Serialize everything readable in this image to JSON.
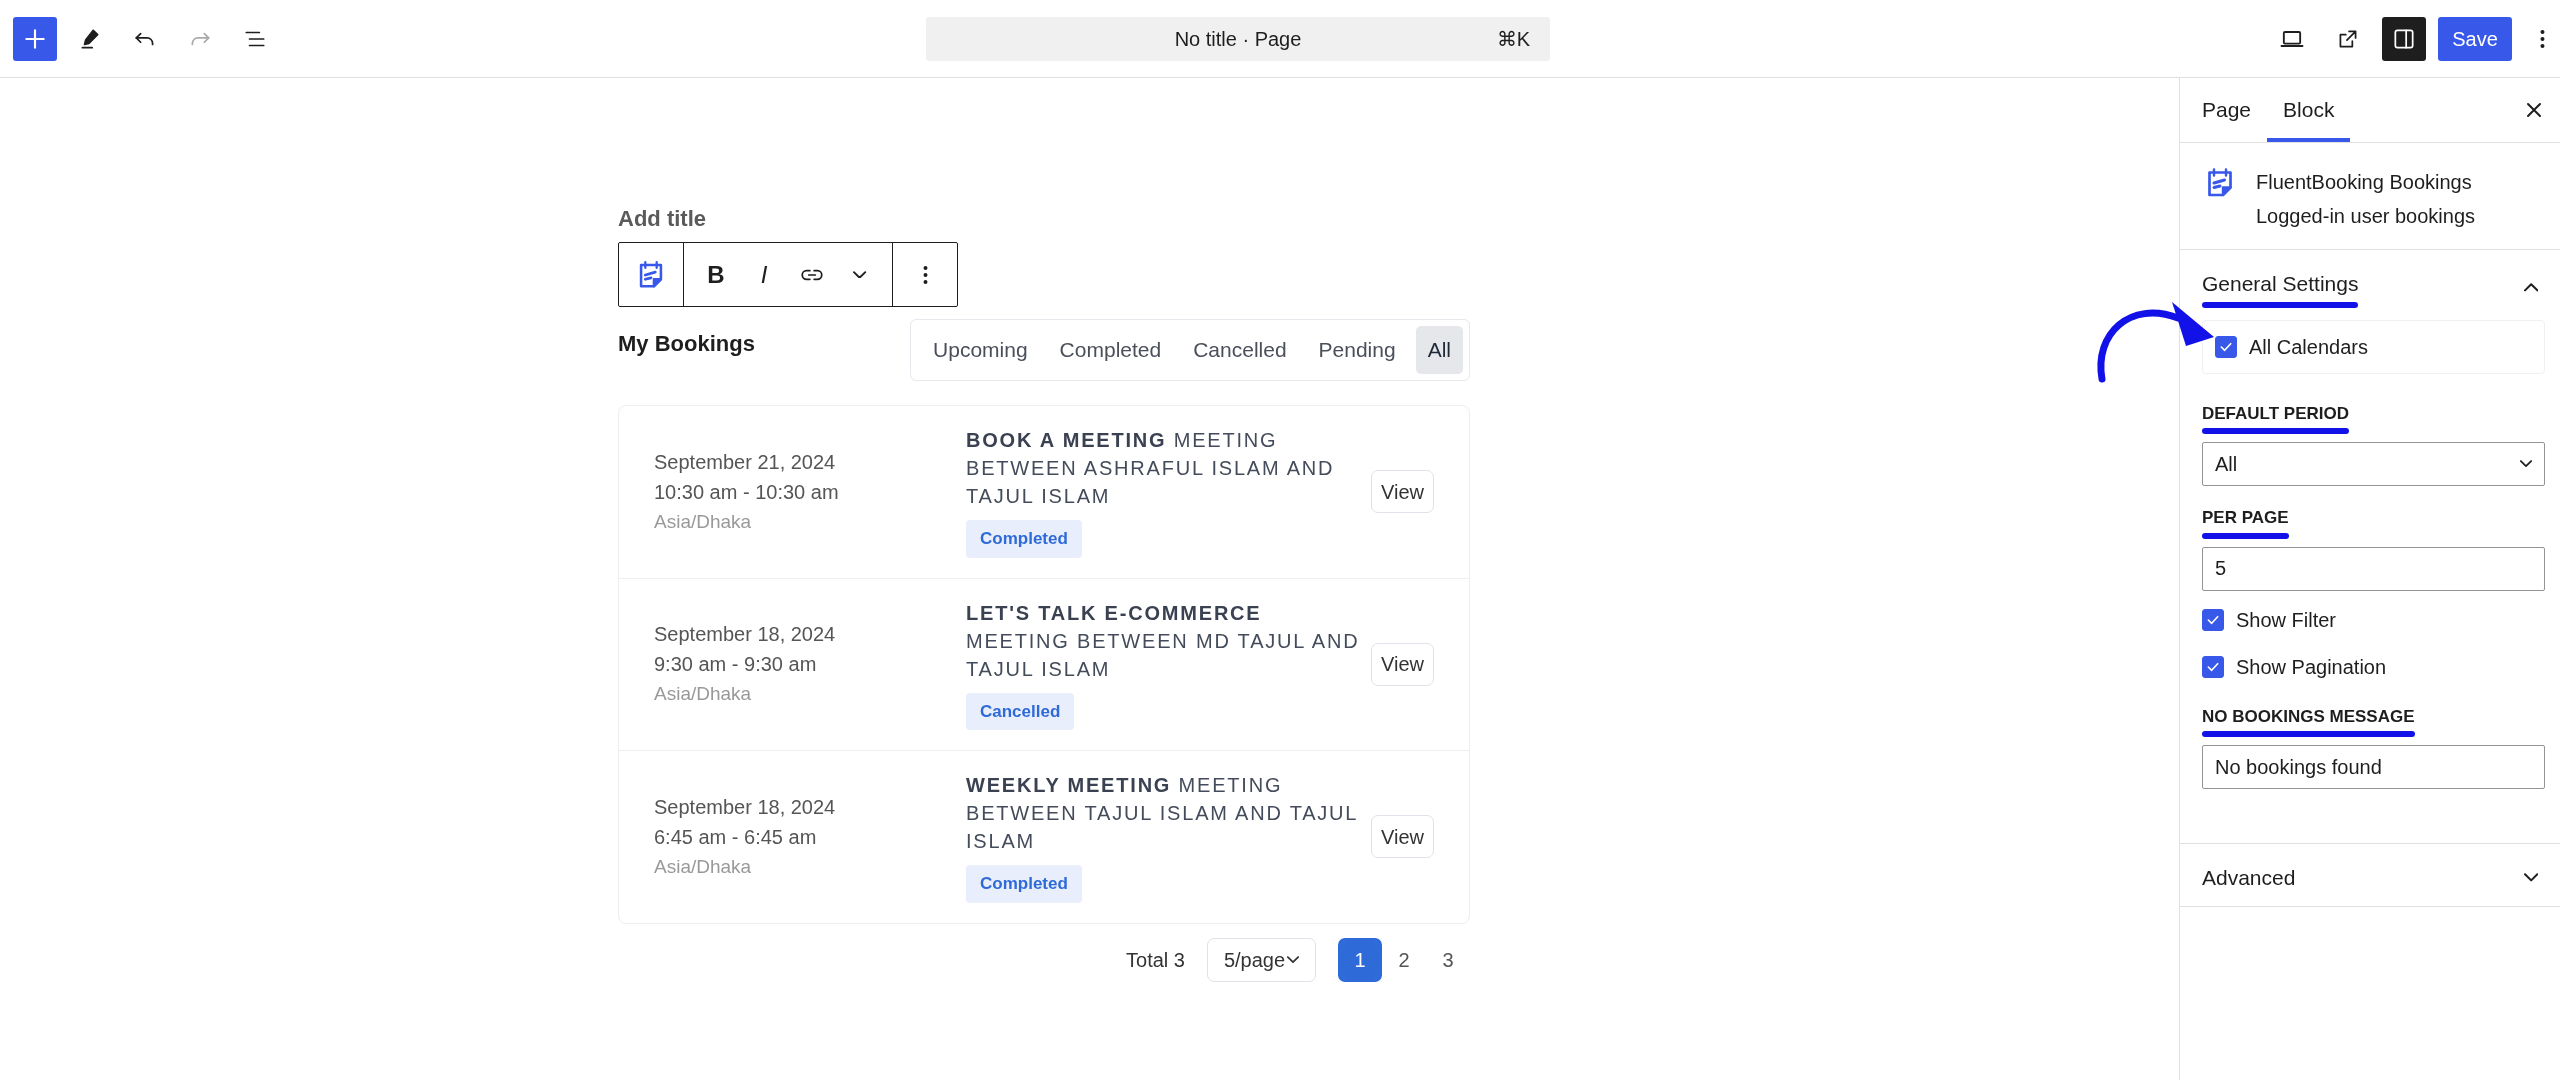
{
  "topbar": {
    "title": "No title · Page",
    "shortcut": "⌘K",
    "save": "Save"
  },
  "editor": {
    "title_placeholder": "Add title",
    "block_toolbar": {
      "format": [
        "B",
        "I"
      ]
    },
    "heading": "My Bookings",
    "filters": [
      {
        "label": "Upcoming",
        "selected": false
      },
      {
        "label": "Completed",
        "selected": false
      },
      {
        "label": "Cancelled",
        "selected": false
      },
      {
        "label": "Pending",
        "selected": false
      },
      {
        "label": "All",
        "selected": true
      }
    ],
    "bookings": [
      {
        "date": "September 21, 2024",
        "time": "10:30 am - 10:30 am",
        "timezone": "Asia/Dhaka",
        "title": "**BOOK A MEETING** MEETING BETWEEN ASHRAFUL ISLAM AND TAJUL ISLAM",
        "status": "Completed",
        "action": "View"
      },
      {
        "date": "September 18, 2024",
        "time": "9:30 am - 9:30 am",
        "timezone": "Asia/Dhaka",
        "title": "**LET'S TALK E-COMMERCE** MEETING BETWEEN MD TAJUL AND TAJUL ISLAM",
        "status": "Cancelled",
        "action": "View"
      },
      {
        "date": "September 18, 2024",
        "time": "6:45 am - 6:45 am",
        "timezone": "Asia/Dhaka",
        "title": "**WEEKLY MEETING** MEETING BETWEEN TAJUL ISLAM AND TAJUL ISLAM",
        "status": "Completed",
        "action": "View"
      }
    ],
    "pagination": {
      "total": "Total 3",
      "page_size": "5/page",
      "pages": [
        {
          "label": "1",
          "selected": true
        },
        {
          "label": "2",
          "selected": false
        },
        {
          "label": "3",
          "selected": false
        }
      ]
    }
  },
  "sidebar": {
    "tabs": [
      {
        "label": "Page",
        "selected": false
      },
      {
        "label": "Block",
        "selected": true
      }
    ],
    "block": {
      "name": "FluentBooking Bookings",
      "description": "Logged-in user bookings"
    },
    "panels": [
      {
        "title": "General Settings",
        "expanded": true,
        "underlined": true,
        "fields": [
          {
            "kind": "checkbox-card",
            "label": "All Calendars",
            "checked": true,
            "arrow": true
          },
          {
            "kind": "select",
            "label": "DEFAULT PERIOD",
            "value": "All",
            "underlined": true
          },
          {
            "kind": "text",
            "label": "PER PAGE",
            "value": "5",
            "underlined": true
          },
          {
            "kind": "checkbox",
            "label": "Show Filter",
            "checked": true
          },
          {
            "kind": "checkbox",
            "label": "Show Pagination",
            "checked": true
          },
          {
            "kind": "text",
            "label": "NO BOOKINGS MESSAGE",
            "value": "No bookings found",
            "underlined": true
          }
        ]
      },
      {
        "title": "Advanced",
        "expanded": false,
        "underlined": false
      }
    ]
  }
}
